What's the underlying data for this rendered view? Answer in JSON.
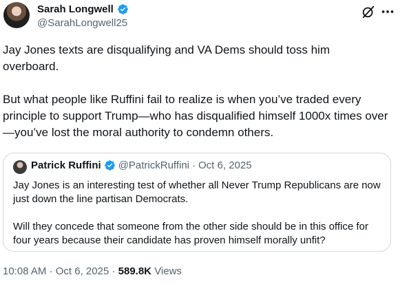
{
  "author": {
    "display_name": "Sarah Longwell",
    "handle": "@SarahLongwell25",
    "verified": true
  },
  "tweet": {
    "text": "Jay Jones texts are disqualifying and VA Dems should toss him overboard.\n\nBut what people like Ruffini fail to realize is when you’ve traded every principle to support Trump—who has disqualified himself 1000x times over—you’ve lost the moral authority to condemn others."
  },
  "quote": {
    "display_name": "Patrick Ruffini",
    "handle": "@PatrickRuffini",
    "separator": "·",
    "date": "Oct 6, 2025",
    "verified": true,
    "text": "Jay Jones is an interesting test of whether all Never Trump Republicans are now just down the line partisan Democrats.\n\nWill they concede that someone from the other side should be in this office for four years because their candidate has proven himself morally unfit?"
  },
  "meta": {
    "time": "10:08 AM",
    "separator": "·",
    "date": "Oct 6, 2025",
    "views_count": "589.8K",
    "views_label": "Views"
  },
  "icons": {
    "verified": "verified-badge-icon",
    "grok": "grok-icon",
    "more": "more-options-icon"
  },
  "colors": {
    "verified_blue": "#1d9bf0",
    "secondary_text": "#536471",
    "border": "#cfd9de"
  }
}
